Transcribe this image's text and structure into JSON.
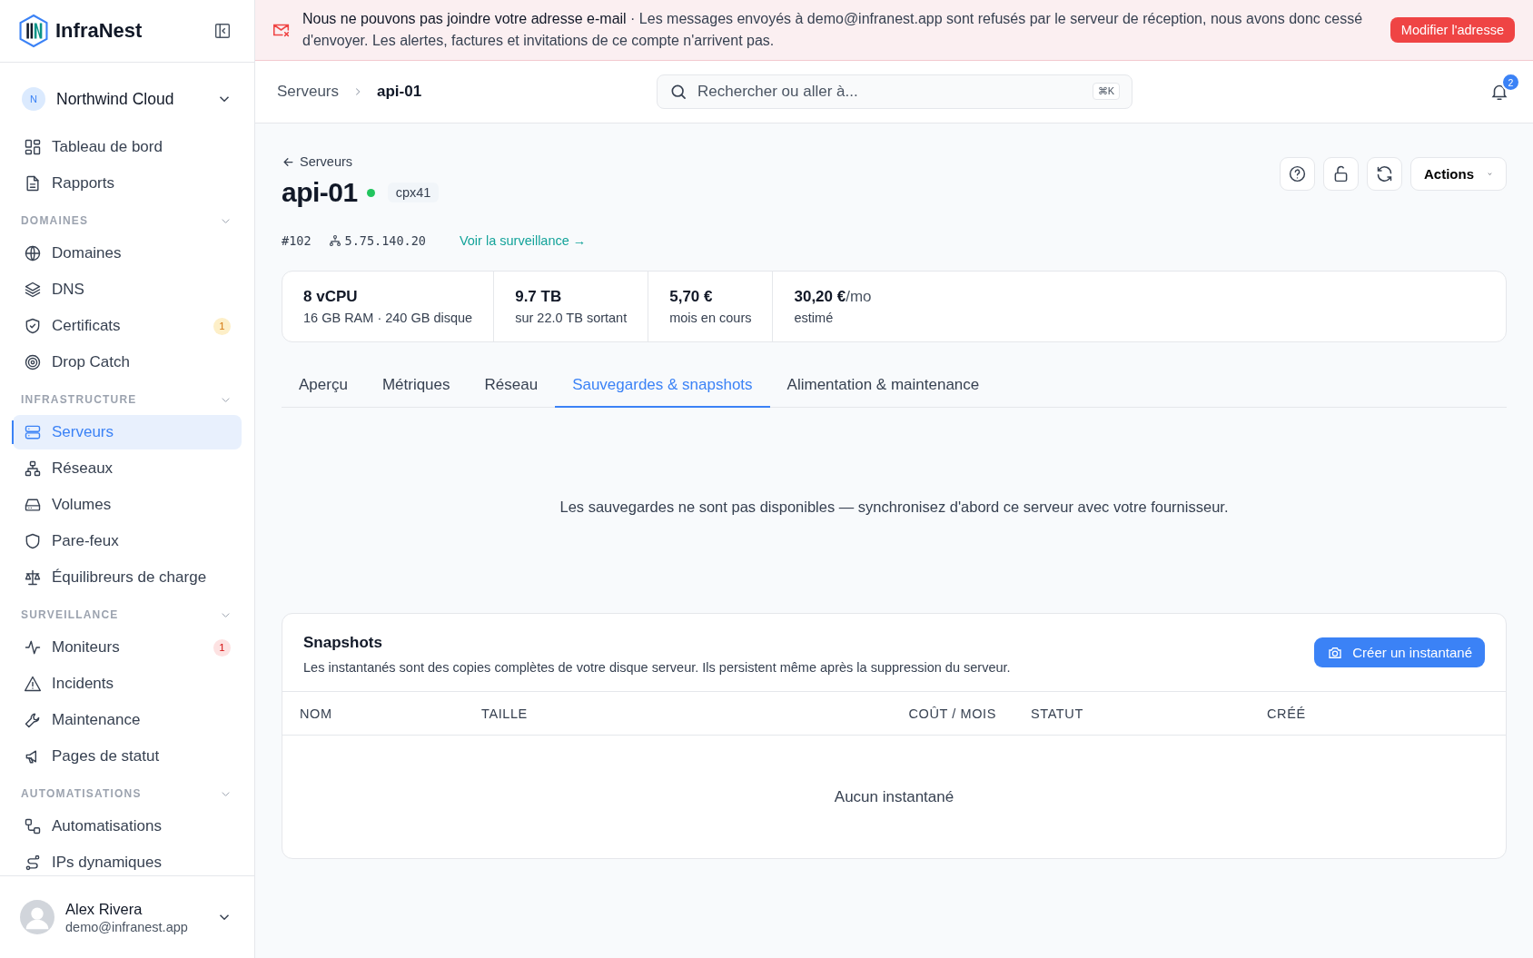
{
  "app": {
    "name": "InfraNest"
  },
  "workspace": {
    "initial": "N",
    "name": "Northwind Cloud"
  },
  "sidebar": {
    "groups": [
      {
        "items": [
          {
            "label": "Tableau de bord",
            "selected": false
          },
          {
            "label": "Rapports",
            "selected": false
          }
        ]
      },
      {
        "title": "DOMAINES",
        "items": [
          {
            "label": "Domaines",
            "selected": false
          },
          {
            "label": "DNS",
            "selected": false
          },
          {
            "label": "Certificats",
            "selected": false,
            "badge": "1",
            "color": "#fdefc8"
          },
          {
            "label": "Drop Catch",
            "selected": false
          }
        ]
      },
      {
        "title": "INFRASTRUCTURE",
        "items": [
          {
            "label": "Serveurs",
            "selected": true
          },
          {
            "label": "Réseaux",
            "selected": false
          },
          {
            "label": "Volumes",
            "selected": false
          },
          {
            "label": "Pare-feux",
            "selected": false
          },
          {
            "label": "Équilibreurs de charge",
            "selected": false
          }
        ]
      },
      {
        "title": "SURVEILLANCE",
        "items": [
          {
            "label": "Moniteurs",
            "selected": false,
            "badge": "1",
            "color": "#fde2e2"
          },
          {
            "label": "Incidents",
            "selected": false
          },
          {
            "label": "Maintenance",
            "selected": false
          },
          {
            "label": "Pages de statut",
            "selected": false
          }
        ]
      },
      {
        "title": "AUTOMATISATIONS",
        "items": [
          {
            "label": "Automatisations",
            "selected": false
          },
          {
            "label": "IPs dynamiques",
            "selected": false
          }
        ]
      }
    ]
  },
  "user": {
    "name": "Alex Rivera",
    "email": "demo@infranest.app"
  },
  "banner": {
    "message": "**Nous ne pouvons pas joindre votre adresse e-mail** · Les messages envoyés à demo@infranest.app sont refusés par le serveur de réception, nous avons donc cessé d'envoyer. Les alertes, factures et invitations de ce compte n'arrivent pas.",
    "action": "Modifier l'adresse"
  },
  "breadcrumb": [
    "Serveurs",
    "api-01"
  ],
  "search": {
    "placeholder": "Rechercher ou aller à...",
    "shortcut": "⌘K"
  },
  "notifications": {
    "count": "2"
  },
  "server": {
    "back": "Serveurs",
    "name": "api-01",
    "online": true,
    "plan": "cpx41",
    "id": "#102",
    "ip": "5.75.140.20",
    "monitor_link": "Voir la surveillance →",
    "actions": "Actions"
  },
  "stats": [
    {
      "value": "8 vCPU",
      "sub": "16 GB RAM · 240 GB disque"
    },
    {
      "value": "9.7 TB",
      "sub": "sur 22.0 TB sortant"
    },
    {
      "value": "5,70 €",
      "sub": "mois en cours"
    },
    {
      "value": "30,20 €",
      "suffix": "/mo",
      "sub": "estimé"
    }
  ],
  "tabs": [
    {
      "label": "Aperçu",
      "selected": false
    },
    {
      "label": "Métriques",
      "selected": false
    },
    {
      "label": "Réseau",
      "selected": false
    },
    {
      "label": "Sauvegardes & snapshots",
      "selected": true
    },
    {
      "label": "Alimentation & maintenance",
      "selected": false
    }
  ],
  "backups_message": "Les sauvegardes ne sont pas disponibles — synchronisez d'abord ce serveur avec votre fournisseur.",
  "snapshots": {
    "title": "Snapshots",
    "description": "Les instantanés sont des copies complètes de votre disque serveur. Ils persistent même après la suppression du serveur.",
    "create_button": "Créer un instantané",
    "columns": [
      "NOM",
      "TAILLE",
      "COÛT / MOIS",
      "STATUT",
      "CRÉÉ"
    ],
    "empty": "Aucun instantané"
  }
}
